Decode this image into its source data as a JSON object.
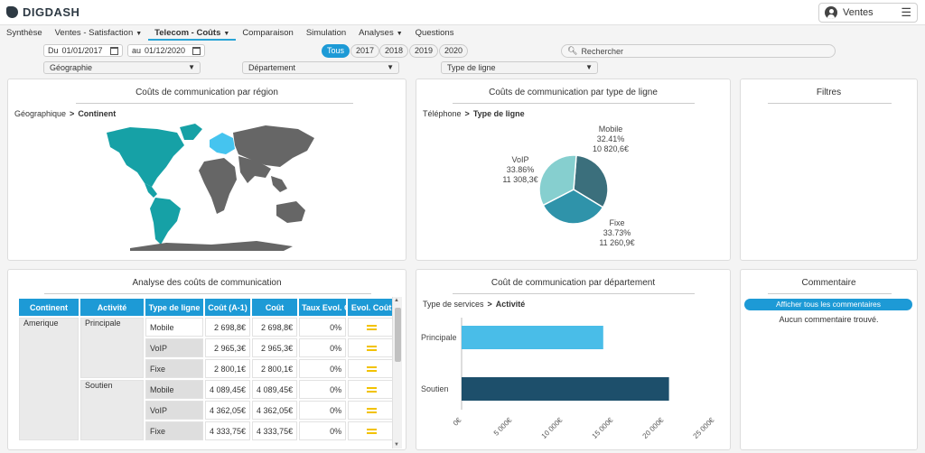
{
  "app": {
    "logo": "DIGDASH",
    "user": "Ventes"
  },
  "tabs": [
    {
      "label": "Synthèse",
      "caret": false,
      "active": false
    },
    {
      "label": "Ventes - Satisfaction",
      "caret": true,
      "active": false
    },
    {
      "label": "Telecom - Coûts",
      "caret": true,
      "active": true
    },
    {
      "label": "Comparaison",
      "caret": false,
      "active": false
    },
    {
      "label": "Simulation",
      "caret": false,
      "active": false
    },
    {
      "label": "Analyses",
      "caret": true,
      "active": false
    },
    {
      "label": "Questions",
      "caret": false,
      "active": false
    }
  ],
  "filters": {
    "date_from_prefix": "Du",
    "date_from": "01/01/2017",
    "date_to_prefix": "au",
    "date_to": "01/12/2020",
    "years": [
      "Tous",
      "2017",
      "2018",
      "2019",
      "2020"
    ],
    "search_placeholder": "Rechercher",
    "dropdowns": [
      "Géographie",
      "Département",
      "Type de ligne"
    ]
  },
  "map_panel": {
    "title": "Coûts de communication par région",
    "crumb_parent": "Géographique",
    "crumb_current": "Continent"
  },
  "pie_panel": {
    "title": "Coûts de communication par type de ligne",
    "crumb_parent": "Téléphone",
    "crumb_current": "Type de ligne"
  },
  "filters_panel": {
    "title": "Filtres"
  },
  "table_panel": {
    "title": "Analyse des coûts de communication",
    "columns": [
      "Continent",
      "Activité",
      "Type de ligne",
      "Coût (A-1)",
      "Coût",
      "Taux Evol. Coût",
      "Evol. Coût"
    ],
    "continent": "Amerique",
    "groups": [
      {
        "activity": "Principale",
        "rows": [
          {
            "type": "Mobile",
            "prev": "2 698,8€",
            "cost": "2 698,8€",
            "rate": "0%"
          },
          {
            "type": "VoIP",
            "prev": "2 965,3€",
            "cost": "2 965,3€",
            "rate": "0%"
          },
          {
            "type": "Fixe",
            "prev": "2 800,1€",
            "cost": "2 800,1€",
            "rate": "0%"
          }
        ]
      },
      {
        "activity": "Soutien",
        "rows": [
          {
            "type": "Mobile",
            "prev": "4 089,45€",
            "cost": "4 089,45€",
            "rate": "0%"
          },
          {
            "type": "VoIP",
            "prev": "4 362,05€",
            "cost": "4 362,05€",
            "rate": "0%"
          },
          {
            "type": "Fixe",
            "prev": "4 333,75€",
            "cost": "4 333,75€",
            "rate": "0%"
          }
        ]
      }
    ]
  },
  "bar_panel": {
    "title": "Coût de communication par département",
    "crumb_parent": "Type de services",
    "crumb_current": "Activité"
  },
  "comment_panel": {
    "title": "Commentaire",
    "button": "Afficher tous les commentaires",
    "empty": "Aucun commentaire trouvé."
  },
  "chart_data": [
    {
      "type": "pie",
      "labels": [
        "Mobile",
        "Fixe",
        "VoIP"
      ],
      "values": [
        10820.6,
        11260.9,
        11308.3
      ],
      "percents": [
        "32.41%",
        "33.73%",
        "33.86%"
      ],
      "value_labels": [
        "10 820,6€",
        "11 260,9€",
        "11 308,3€"
      ],
      "colors": [
        "#3b6f7c",
        "#2f93aa",
        "#86cfcf"
      ]
    },
    {
      "type": "bar",
      "orientation": "horizontal",
      "categories": [
        "Principale",
        "Soutien"
      ],
      "values": [
        14000,
        20500
      ],
      "colors": [
        "#49bde8",
        "#1d4f6b"
      ],
      "xlim": [
        0,
        25000
      ],
      "xticks": [
        "0€",
        "5 000€",
        "10 000€",
        "15 000€",
        "20 000€",
        "25 000€"
      ]
    }
  ]
}
